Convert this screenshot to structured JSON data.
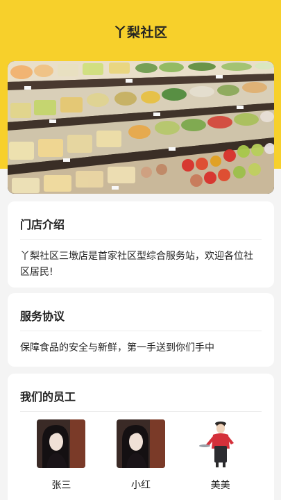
{
  "header": {
    "title": "丫梨社区"
  },
  "banner": {
    "alt": "supermarket produce shelves"
  },
  "intro": {
    "title": "门店介绍",
    "text": "丫梨社区三墩店是首家社区型综合服务站，欢迎各位社区居民!"
  },
  "agreement": {
    "title": "服务协议",
    "text": "保障食品的安全与新鲜，第一手送到你们手中"
  },
  "staff": {
    "title": "我们的员工",
    "members": [
      {
        "name": "张三"
      },
      {
        "name": "小红"
      },
      {
        "name": "美美"
      }
    ]
  },
  "colors": {
    "accent": "#f7d02b",
    "background": "#f4f4f4"
  }
}
